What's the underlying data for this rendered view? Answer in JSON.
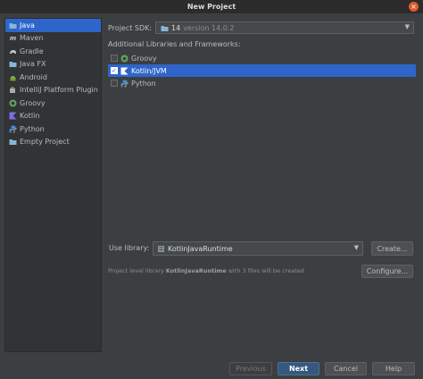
{
  "window": {
    "title": "New Project"
  },
  "sidebar": {
    "items": [
      {
        "label": "Java",
        "icon": "folder-icon",
        "selected": true
      },
      {
        "label": "Maven",
        "icon": "maven-icon"
      },
      {
        "label": "Gradle",
        "icon": "gradle-icon"
      },
      {
        "label": "Java FX",
        "icon": "folder-icon"
      },
      {
        "label": "Android",
        "icon": "android-icon"
      },
      {
        "label": "IntelliJ Platform Plugin",
        "icon": "plugin-icon"
      },
      {
        "label": "Groovy",
        "icon": "groovy-icon"
      },
      {
        "label": "Kotlin",
        "icon": "kotlin-icon"
      },
      {
        "label": "Python",
        "icon": "python-icon"
      },
      {
        "label": "Empty Project",
        "icon": "folder-icon"
      }
    ]
  },
  "sdk": {
    "label": "Project SDK:",
    "value": "14",
    "version": "version 14.0.2"
  },
  "frameworks": {
    "label": "Additional Libraries and Frameworks:",
    "items": [
      {
        "label": "Groovy",
        "checked": false
      },
      {
        "label": "Kotlin/JVM",
        "checked": true
      },
      {
        "label": "Python",
        "checked": false
      }
    ]
  },
  "library": {
    "label": "Use library:",
    "value": "KotlinJavaRuntime",
    "create_label": "Create...",
    "configure_label": "Configure...",
    "note_prefix": "Project level library",
    "note_name": "KotlinJavaRuntime",
    "note_suffix": "with 3 files will be created"
  },
  "footer": {
    "previous": "Previous",
    "next": "Next",
    "cancel": "Cancel",
    "help": "Help"
  },
  "colors": {
    "selection": "#2f65ca",
    "background": "#3c3f41",
    "primary_button": "#365880"
  }
}
